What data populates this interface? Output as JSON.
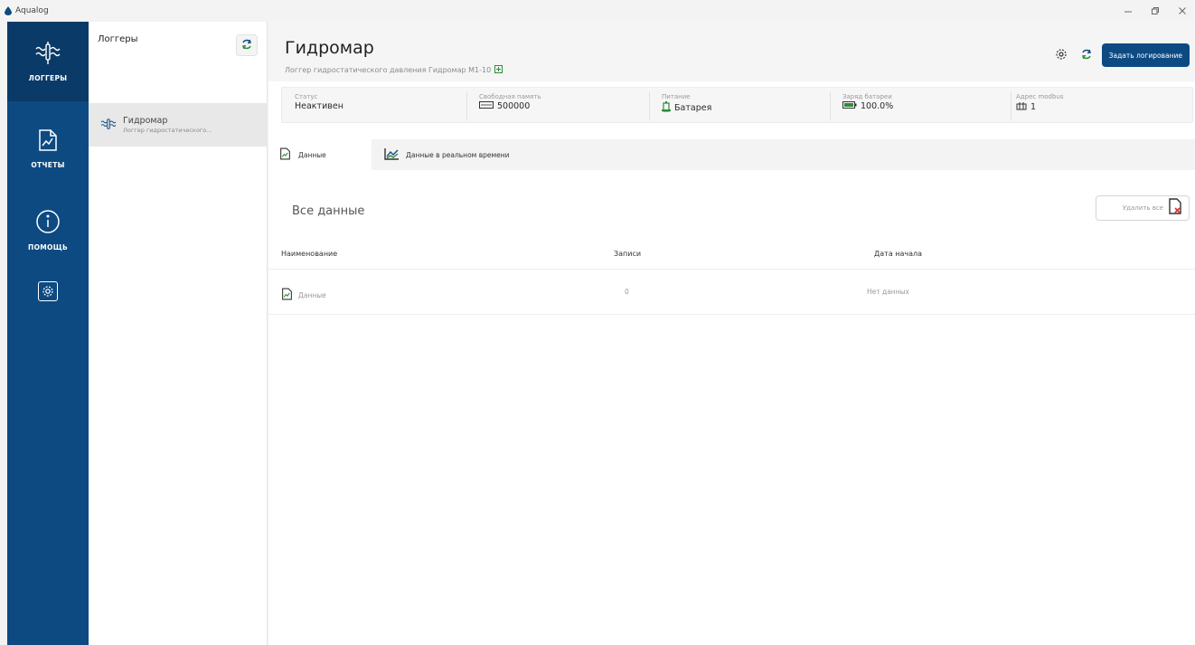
{
  "window": {
    "title": "Aqualog"
  },
  "nav": [
    {
      "label": "ЛОГГЕРЫ",
      "icon": "sensor-waves-icon"
    },
    {
      "label": "ОТЧЕТЫ",
      "icon": "report-icon"
    },
    {
      "label": "ПОМОЩЬ",
      "icon": "info-icon"
    },
    {
      "label": "",
      "icon": "settings-icon"
    }
  ],
  "loggers_panel": {
    "title": "Логгеры",
    "items": [
      {
        "name": "Гидромар",
        "desc": "Логгер гидростатического..."
      }
    ]
  },
  "header": {
    "title": "Гидромар",
    "subtitle": "Логгер гидростатического давления Гидромар М1-10",
    "primary_button": "Задать логирование"
  },
  "stats": [
    {
      "label": "Статус",
      "value": "Неактивен"
    },
    {
      "label": "Свободная память",
      "value": "500000"
    },
    {
      "label": "Питание",
      "value": "Батарея"
    },
    {
      "label": "Заряд батареи",
      "value": "100.0%"
    },
    {
      "label": "Адрес modbus",
      "value": "1"
    }
  ],
  "tabs": [
    {
      "label": "Данные"
    },
    {
      "label": "Данные в реальном времени"
    }
  ],
  "section": {
    "title": "Все данные",
    "delete_all": "Удалить все"
  },
  "table": {
    "columns": [
      "Наименование",
      "Записи",
      "Дата начала"
    ],
    "rows": [
      {
        "name": "Данные",
        "records": "0",
        "start": "Нет данных"
      }
    ]
  },
  "colors": {
    "nav_bg": "#0d4a82",
    "accent": "#0d4a82",
    "success": "#2e8b3a",
    "danger": "#d63a3a"
  }
}
